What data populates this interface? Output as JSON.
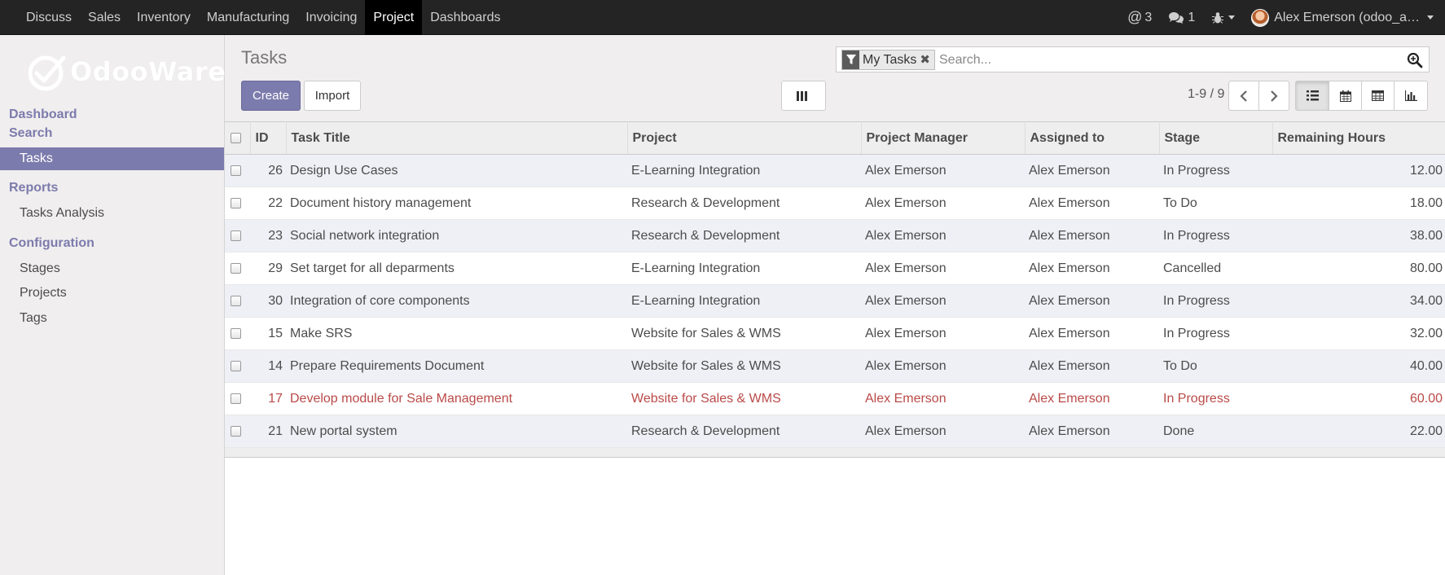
{
  "topbar": {
    "menu": [
      "Discuss",
      "Sales",
      "Inventory",
      "Manufacturing",
      "Invoicing",
      "Project",
      "Dashboards"
    ],
    "active_menu": "Project",
    "mentions_count": "3",
    "messages_count": "1",
    "user_label": "Alex Emerson (odoo_a…"
  },
  "logo": {
    "text": "OdooWare"
  },
  "sidebar": {
    "sections": {
      "dashboard": "Dashboard",
      "search": "Search",
      "reports": "Reports",
      "configuration": "Configuration"
    },
    "items": {
      "tasks": "Tasks",
      "tasks_analysis": "Tasks Analysis",
      "stages": "Stages",
      "projects": "Projects",
      "tags": "Tags"
    }
  },
  "control_panel": {
    "breadcrumb": "Tasks",
    "create_label": "Create",
    "import_label": "Import",
    "search_facet": "My Tasks",
    "search_placeholder": "Search...",
    "pager": "1-9 / 9",
    "active_view": "list"
  },
  "table": {
    "columns": [
      "ID",
      "Task Title",
      "Project",
      "Project Manager",
      "Assigned to",
      "Stage",
      "Remaining Hours"
    ],
    "rows": [
      {
        "id": "26",
        "title": "Design Use Cases",
        "project": "E-Learning Integration",
        "manager": "Alex Emerson",
        "assigned": "Alex Emerson",
        "stage": "In Progress",
        "hours": "12.00",
        "overdue": false
      },
      {
        "id": "22",
        "title": "Document history management",
        "project": "Research & Development",
        "manager": "Alex Emerson",
        "assigned": "Alex Emerson",
        "stage": "To Do",
        "hours": "18.00",
        "overdue": false
      },
      {
        "id": "23",
        "title": "Social network integration",
        "project": "Research & Development",
        "manager": "Alex Emerson",
        "assigned": "Alex Emerson",
        "stage": "In Progress",
        "hours": "38.00",
        "overdue": false
      },
      {
        "id": "29",
        "title": "Set target for all deparments",
        "project": "E-Learning Integration",
        "manager": "Alex Emerson",
        "assigned": "Alex Emerson",
        "stage": "Cancelled",
        "hours": "80.00",
        "overdue": false
      },
      {
        "id": "30",
        "title": "Integration of core components",
        "project": "E-Learning Integration",
        "manager": "Alex Emerson",
        "assigned": "Alex Emerson",
        "stage": "In Progress",
        "hours": "34.00",
        "overdue": false
      },
      {
        "id": "15",
        "title": "Make SRS",
        "project": "Website for Sales & WMS",
        "manager": "Alex Emerson",
        "assigned": "Alex Emerson",
        "stage": "In Progress",
        "hours": "32.00",
        "overdue": false
      },
      {
        "id": "14",
        "title": "Prepare Requirements Document",
        "project": "Website for Sales & WMS",
        "manager": "Alex Emerson",
        "assigned": "Alex Emerson",
        "stage": "To Do",
        "hours": "40.00",
        "overdue": false
      },
      {
        "id": "17",
        "title": "Develop module for Sale Management",
        "project": "Website for Sales & WMS",
        "manager": "Alex Emerson",
        "assigned": "Alex Emerson",
        "stage": "In Progress",
        "hours": "60.00",
        "overdue": true
      },
      {
        "id": "21",
        "title": "New portal system",
        "project": "Research & Development",
        "manager": "Alex Emerson",
        "assigned": "Alex Emerson",
        "stage": "Done",
        "hours": "22.00",
        "overdue": false
      }
    ]
  },
  "colors": {
    "brand": "#7c7bad",
    "topbar": "#242424",
    "overdue_text": "#b94a48"
  }
}
